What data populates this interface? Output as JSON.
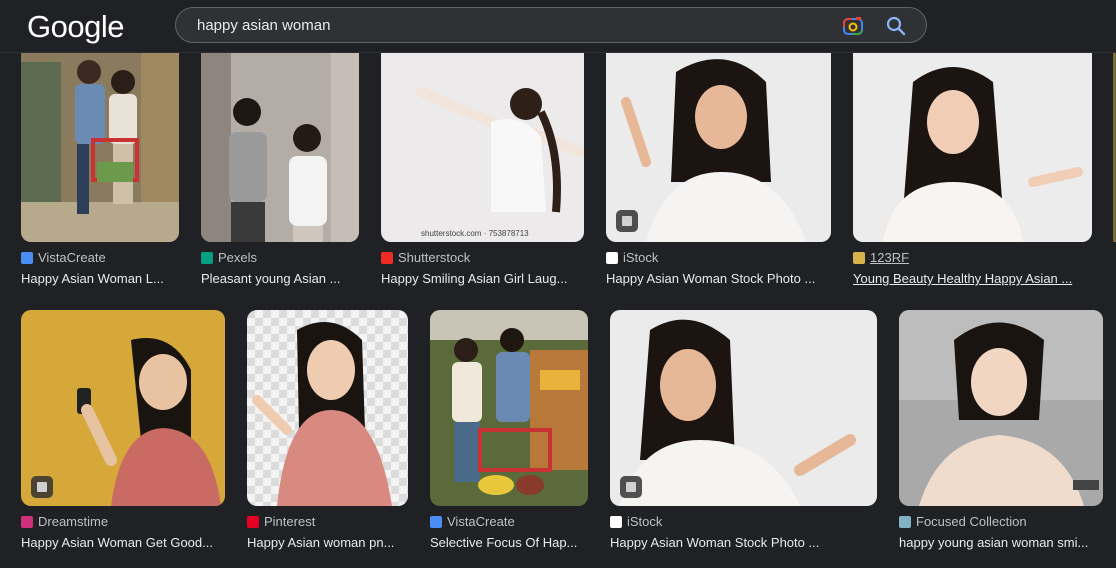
{
  "header": {
    "logo": "Google",
    "search_value": "happy asian woman"
  },
  "results": [
    {
      "source": "VistaCreate",
      "title": "Happy Asian Woman L...",
      "favicon_color": "#4a8ef5"
    },
    {
      "source": "Pexels",
      "title": "Pleasant young Asian ...",
      "favicon_color": "#05a081"
    },
    {
      "source": "Shutterstock",
      "title": "Happy Smiling Asian Girl Laug...",
      "favicon_color": "#ee2b24",
      "watermark": "shutterstock.com · 753878713"
    },
    {
      "source": "iStock",
      "title": "Happy Asian Woman Stock Photo ...",
      "favicon_color": "#ffffff"
    },
    {
      "source": "123RF",
      "title": "Young Beauty Healthy Happy Asian ...",
      "favicon_color": "#d6b24a"
    },
    {
      "source": "Dreamstime",
      "title": "Happy Asian Woman Get Good...",
      "favicon_color": "#d0307a"
    },
    {
      "source": "Pinterest",
      "title": "Happy Asian woman pn...",
      "favicon_color": "#e60023"
    },
    {
      "source": "VistaCreate",
      "title": "Selective Focus Of Hap...",
      "favicon_color": "#4a8ef5"
    },
    {
      "source": "iStock",
      "title": "Happy Asian Woman Stock Photo ...",
      "favicon_color": "#ffffff"
    },
    {
      "source": "Focused Collection",
      "title": "happy young asian woman smi...",
      "favicon_color": "#7fb3c4"
    }
  ]
}
